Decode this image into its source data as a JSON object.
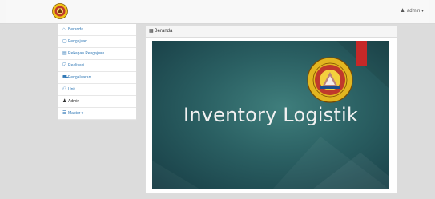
{
  "header": {
    "user_label": "admin",
    "user_caret": "▾"
  },
  "sidebar": {
    "items": [
      {
        "label": "Beranda",
        "icon": "home-icon",
        "glyph": "⌂"
      },
      {
        "label": "Pengajuan",
        "icon": "file-icon",
        "glyph": "▢"
      },
      {
        "label": "Rekapan Pengajuan",
        "icon": "book-icon",
        "glyph": "▤"
      },
      {
        "label": "Realisasi",
        "icon": "check-square-icon",
        "glyph": "☑"
      },
      {
        "label": "Pengeluaran",
        "icon": "cart-icon",
        "glyph": "⛟"
      },
      {
        "label": "Unit",
        "icon": "users-icon",
        "glyph": "⚇"
      },
      {
        "label": "Admin",
        "icon": "user-icon",
        "glyph": "♟"
      },
      {
        "label": "Master",
        "icon": "list-icon",
        "glyph": "☰",
        "caret": "▾"
      }
    ]
  },
  "panel": {
    "title": "Beranda",
    "icon": "calendar-icon",
    "glyph": "▦"
  },
  "slide": {
    "title": "Inventory Logistik"
  },
  "colors": {
    "link": "#337ab7",
    "slide_bg": "#2a5f62",
    "ribbon": "#c62828",
    "page_bg": "#dcdcdc"
  }
}
